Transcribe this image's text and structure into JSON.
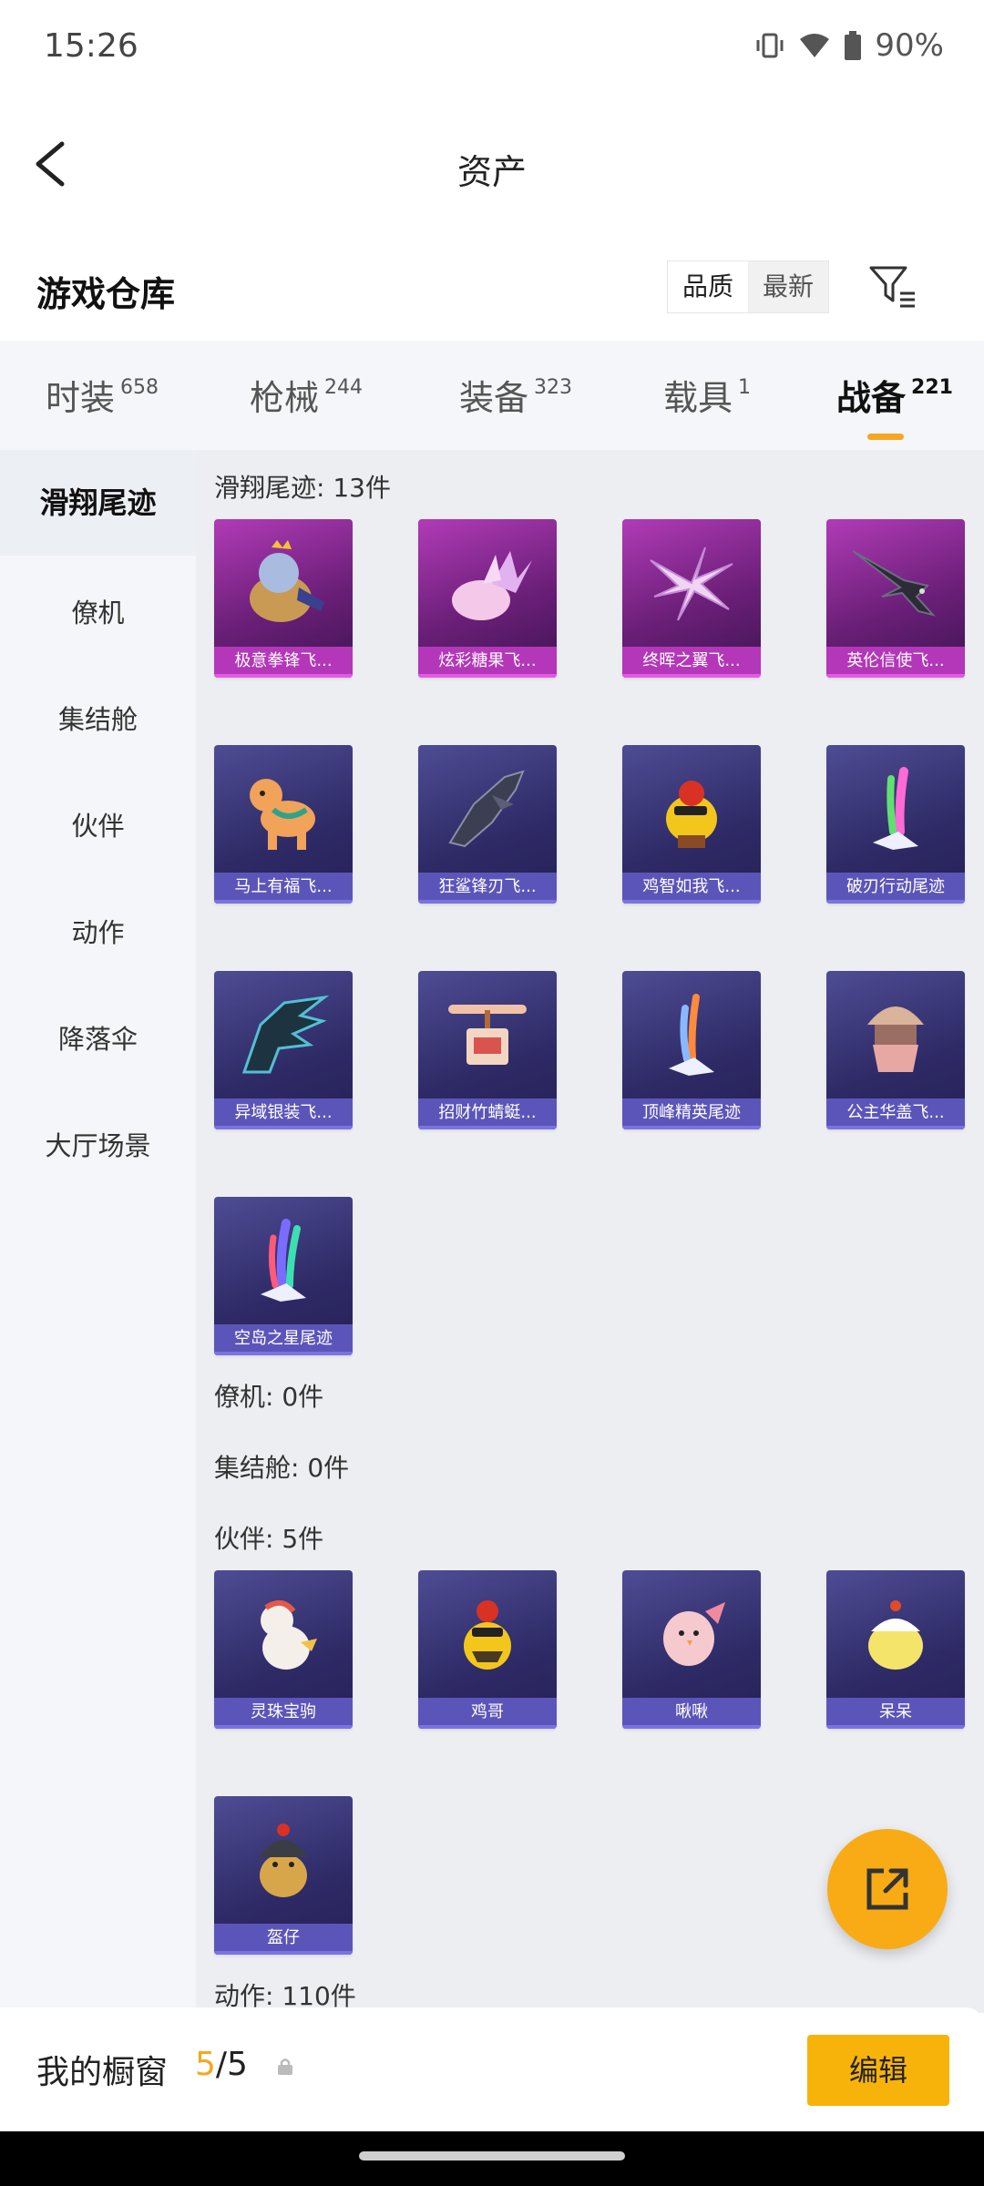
{
  "status_bar": {
    "time": "15:26",
    "battery": "90%"
  },
  "header": {
    "title": "资产"
  },
  "warehouse": {
    "title": "游戏仓库",
    "sort_options": [
      "品质",
      "最新"
    ],
    "active_sort": "品质"
  },
  "tabs": [
    {
      "label": "时装",
      "count": "658"
    },
    {
      "label": "枪械",
      "count": "244"
    },
    {
      "label": "装备",
      "count": "323"
    },
    {
      "label": "载具",
      "count": "1"
    },
    {
      "label": "战备",
      "count": "221",
      "active": true
    }
  ],
  "sidebar": [
    "滑翔尾迹",
    "僚机",
    "集结舱",
    "伙伴",
    "动作",
    "降落伞",
    "大厅场景"
  ],
  "groups": {
    "glide": {
      "label": "滑翔尾迹: 13件",
      "items": [
        "极意拳锋飞...",
        "炫彩糖果飞...",
        "终晖之翼飞...",
        "英伦信使飞...",
        "马上有福飞...",
        "狂鲨锋刃飞...",
        "鸡智如我飞...",
        "破刃行动尾迹",
        "异域银装飞...",
        "招财竹蜻蜓...",
        "顶峰精英尾迹",
        "公主华盖飞...",
        "空岛之星尾迹"
      ]
    },
    "wingman": {
      "label": "僚机: 0件"
    },
    "pod": {
      "label": "集结舱: 0件"
    },
    "partner": {
      "label": "伙伴: 5件",
      "items": [
        "灵珠宝驹",
        "鸡哥",
        "啾啾",
        "呆呆",
        "盔仔"
      ]
    },
    "action": {
      "label": "动作: 110件"
    }
  },
  "showcase": {
    "label": "我的橱窗",
    "current": "5",
    "total": "/5",
    "edit_label": "编辑"
  },
  "colors": {
    "accent": "#f8ab14",
    "card_purple": "#5c55b9",
    "card_pink": "#b337b8"
  }
}
